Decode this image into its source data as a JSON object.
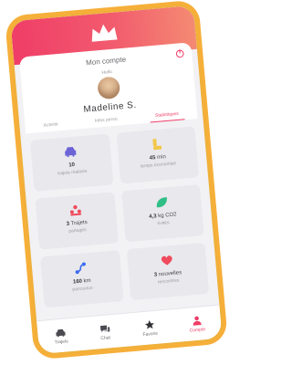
{
  "header": {
    "title": "Mon compte",
    "small_label": "Hello",
    "user_name": "Madeline S."
  },
  "tabs": [
    {
      "label": "Activité"
    },
    {
      "label": "Infos perso."
    },
    {
      "label": "Statistiques",
      "active": true
    }
  ],
  "stats": [
    {
      "icon": "car-icon",
      "value": "10",
      "unit": "",
      "label": "trajets réalisés",
      "color": "#6b63d6"
    },
    {
      "icon": "person-icon",
      "value": "45",
      "unit": "min",
      "label": "temps économisé",
      "color": "#f2c74a"
    },
    {
      "icon": "group-icon",
      "value": "3",
      "unit": "Trajets",
      "label": "partagés",
      "color": "#ef4b5d"
    },
    {
      "icon": "leaf-icon",
      "value": "4,3",
      "unit": "kg CO2",
      "label": "évités",
      "color": "#2fbf86"
    },
    {
      "icon": "route-icon",
      "value": "160",
      "unit": "km",
      "label": "parcourus",
      "color": "#3a6cf0"
    },
    {
      "icon": "heart-icon",
      "value": "3",
      "unit": "nouvelles",
      "label": "rencontres",
      "color": "#ef4b5d"
    }
  ],
  "bottom_nav": [
    {
      "label": "Trajets",
      "icon": "car-icon"
    },
    {
      "label": "Chat",
      "icon": "chat-icon"
    },
    {
      "label": "Favoris",
      "icon": "star-icon"
    },
    {
      "label": "Compte",
      "icon": "account-icon",
      "active": true
    }
  ],
  "colors": {
    "accent": "#ef3d67",
    "frame": "#f5a623"
  }
}
